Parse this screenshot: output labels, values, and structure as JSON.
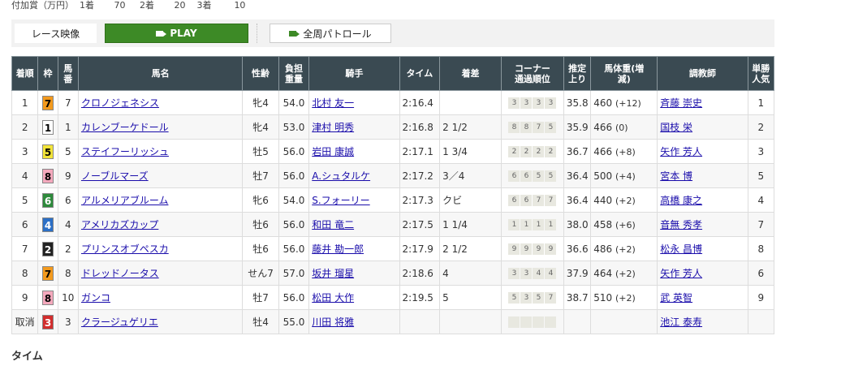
{
  "prize": {
    "label": "付加賞（万円）",
    "items": [
      {
        "rank": "1着",
        "value": "70"
      },
      {
        "rank": "2着",
        "value": "20"
      },
      {
        "rank": "3着",
        "value": "10"
      }
    ]
  },
  "toolbar": {
    "race_video": "レース映像",
    "play": "PLAY",
    "patrol": "全周パトロール"
  },
  "headers": [
    "着順",
    "枠",
    "馬番",
    "馬名",
    "性齢",
    "負担重量",
    "騎手",
    "タイム",
    "着差",
    "コーナー通過順位",
    "推定上り",
    "馬体重(増減)",
    "調教師",
    "単勝人気"
  ],
  "rows": [
    {
      "place": "1",
      "waku": "7",
      "num": "7",
      "horse": "クロノジェネシス",
      "sexage": "牝4",
      "weight": "54.0",
      "jockey": "北村 友一",
      "time": "2:16.4",
      "margin": "",
      "corners": [
        "3",
        "3",
        "3",
        "3"
      ],
      "last3f": "35.8",
      "bw": "460",
      "bwd": "(+12)",
      "trainer": "斉藤 崇史",
      "pop": "1"
    },
    {
      "place": "2",
      "waku": "1",
      "num": "1",
      "horse": "カレンブーケドール",
      "sexage": "牝4",
      "weight": "53.0",
      "jockey": "津村 明秀",
      "time": "2:16.8",
      "margin": "2 1/2",
      "corners": [
        "8",
        "8",
        "7",
        "5"
      ],
      "last3f": "35.9",
      "bw": "466",
      "bwd": "(0)",
      "trainer": "国枝 栄",
      "pop": "2"
    },
    {
      "place": "3",
      "waku": "5",
      "num": "5",
      "horse": "ステイフーリッシュ",
      "sexage": "牡5",
      "weight": "56.0",
      "jockey": "岩田 康誠",
      "time": "2:17.1",
      "margin": "1 3/4",
      "corners": [
        "2",
        "2",
        "2",
        "2"
      ],
      "last3f": "36.7",
      "bw": "466",
      "bwd": "(+8)",
      "trainer": "矢作 芳人",
      "pop": "3"
    },
    {
      "place": "4",
      "waku": "8",
      "num": "9",
      "horse": "ノーブルマーズ",
      "sexage": "牡7",
      "weight": "56.0",
      "jockey": "A.シュタルケ",
      "time": "2:17.2",
      "margin": "3／4",
      "corners": [
        "6",
        "6",
        "5",
        "5"
      ],
      "last3f": "36.4",
      "bw": "500",
      "bwd": "(+4)",
      "trainer": "宮本 博",
      "pop": "5"
    },
    {
      "place": "5",
      "waku": "6",
      "num": "6",
      "horse": "アルメリアブルーム",
      "sexage": "牝6",
      "weight": "54.0",
      "jockey": "S.フォーリー",
      "time": "2:17.3",
      "margin": "クビ",
      "corners": [
        "6",
        "6",
        "7",
        "7"
      ],
      "last3f": "36.4",
      "bw": "440",
      "bwd": "(+2)",
      "trainer": "高橋 康之",
      "pop": "4"
    },
    {
      "place": "6",
      "waku": "4",
      "num": "4",
      "horse": "アメリカズカップ",
      "sexage": "牡6",
      "weight": "56.0",
      "jockey": "和田 竜二",
      "time": "2:17.5",
      "margin": "1 1/4",
      "corners": [
        "1",
        "1",
        "1",
        "1"
      ],
      "last3f": "38.0",
      "bw": "458",
      "bwd": "(+6)",
      "trainer": "音無 秀孝",
      "pop": "7"
    },
    {
      "place": "7",
      "waku": "2",
      "num": "2",
      "horse": "プリンスオブペスカ",
      "sexage": "牡6",
      "weight": "56.0",
      "jockey": "藤井 勘一郎",
      "time": "2:17.9",
      "margin": "2 1/2",
      "corners": [
        "9",
        "9",
        "9",
        "9"
      ],
      "last3f": "36.6",
      "bw": "486",
      "bwd": "(+2)",
      "trainer": "松永 昌博",
      "pop": "8"
    },
    {
      "place": "8",
      "waku": "7",
      "num": "8",
      "horse": "ドレッドノータス",
      "sexage": "せん7",
      "weight": "57.0",
      "jockey": "坂井 瑠星",
      "time": "2:18.6",
      "margin": "4",
      "corners": [
        "3",
        "3",
        "4",
        "4"
      ],
      "last3f": "37.9",
      "bw": "464",
      "bwd": "(+2)",
      "trainer": "矢作 芳人",
      "pop": "6"
    },
    {
      "place": "9",
      "waku": "8",
      "num": "10",
      "horse": "ガンコ",
      "sexage": "牡7",
      "weight": "56.0",
      "jockey": "松田 大作",
      "time": "2:19.5",
      "margin": "5",
      "corners": [
        "5",
        "3",
        "5",
        "7"
      ],
      "last3f": "38.7",
      "bw": "510",
      "bwd": "(+2)",
      "trainer": "武 英智",
      "pop": "9"
    },
    {
      "place": "取消",
      "waku": "3",
      "num": "3",
      "horse": "クラージュゲリエ",
      "sexage": "牡4",
      "weight": "55.0",
      "jockey": "川田 将雅",
      "time": "",
      "margin": "",
      "corners": [
        "",
        "",
        "",
        ""
      ],
      "last3f": "",
      "bw": "",
      "bwd": "",
      "trainer": "池江 泰寿",
      "pop": ""
    }
  ],
  "waku_colors": {
    "1": {
      "bg": "#ffffff",
      "fg": "#000000"
    },
    "2": {
      "bg": "#222222",
      "fg": "#ffffff"
    },
    "3": {
      "bg": "#d22d2d",
      "fg": "#ffffff"
    },
    "4": {
      "bg": "#2b6fc6",
      "fg": "#ffffff"
    },
    "5": {
      "bg": "#f2e43a",
      "fg": "#000000"
    },
    "6": {
      "bg": "#2e8a3c",
      "fg": "#ffffff"
    },
    "7": {
      "bg": "#f39a1e",
      "fg": "#000000"
    },
    "8": {
      "bg": "#f4a9bd",
      "fg": "#000000"
    }
  },
  "section_title": "タイム"
}
